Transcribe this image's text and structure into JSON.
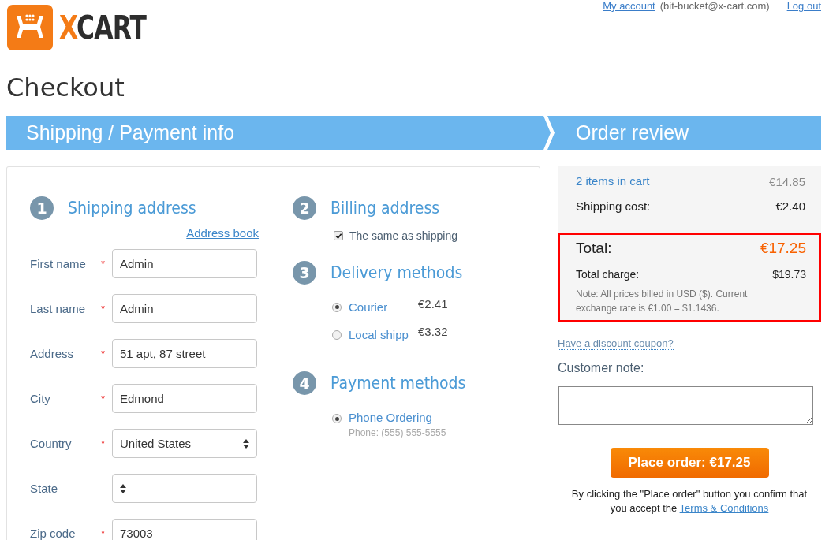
{
  "header_links": [
    {
      "kind": "link",
      "text": "My account"
    },
    {
      "kind": "text",
      "text": "(bit-bucket@x-cart.com)"
    },
    {
      "kind": "link",
      "text": "Log out"
    }
  ],
  "logo": {
    "accent": "X",
    "rest": "CART"
  },
  "page_title": "Checkout",
  "steps": [
    "Shipping / Payment info",
    "Order review"
  ],
  "shipping": {
    "number": "1",
    "title": "Shipping address",
    "address_book": "Address book",
    "fields": [
      {
        "kind": "text",
        "label": "First name",
        "marker": "*",
        "value": "Admin"
      },
      {
        "kind": "text",
        "label": "Last name",
        "marker": "*",
        "value": "Admin"
      },
      {
        "kind": "text",
        "label": "Address",
        "marker": "*",
        "value": "51 apt, 87 street"
      },
      {
        "kind": "text",
        "label": "City",
        "marker": "*",
        "value": "Edmond"
      },
      {
        "kind": "select",
        "label": "Country",
        "marker": "*",
        "value": "United States"
      },
      {
        "kind": "select",
        "label": "State"
      },
      {
        "kind": "text",
        "label": "Zip code",
        "marker": "*",
        "value": "73003"
      }
    ]
  },
  "billing": {
    "number": "2",
    "title": "Billing address",
    "same_as_shipping": {
      "label": "The same as shipping",
      "checked": true
    }
  },
  "delivery": {
    "number": "3",
    "title": "Delivery methods",
    "options": [
      {
        "label": "Courier",
        "price": "€2.41",
        "selected": true
      },
      {
        "label": "Local shipp",
        "price": "€3.32",
        "selected": false
      }
    ]
  },
  "payment": {
    "number": "4",
    "title": "Payment methods",
    "options": [
      {
        "label": "Phone Ordering",
        "note": "Phone: (555) 555-5555",
        "selected": true
      }
    ]
  },
  "summary": {
    "items_link": "2 items in cart",
    "items_total": "€14.85",
    "shipping_label": "Shipping cost:",
    "shipping_value": "€2.40",
    "total_label": "Total:",
    "total_value": "€17.25",
    "charge_label": "Total charge:",
    "charge_value": "$19.73",
    "note": "Note: All prices billed in USD ($). Current exchange rate is €1.00 = $1.1436."
  },
  "coupon_link": "Have a discount coupon?",
  "customer_note_label": "Customer note:",
  "place_order": "Place order: €17.25",
  "terms_text": "By clicking the \"Place order\" button you confirm that you accept the",
  "terms_link": "Terms & Conditions"
}
